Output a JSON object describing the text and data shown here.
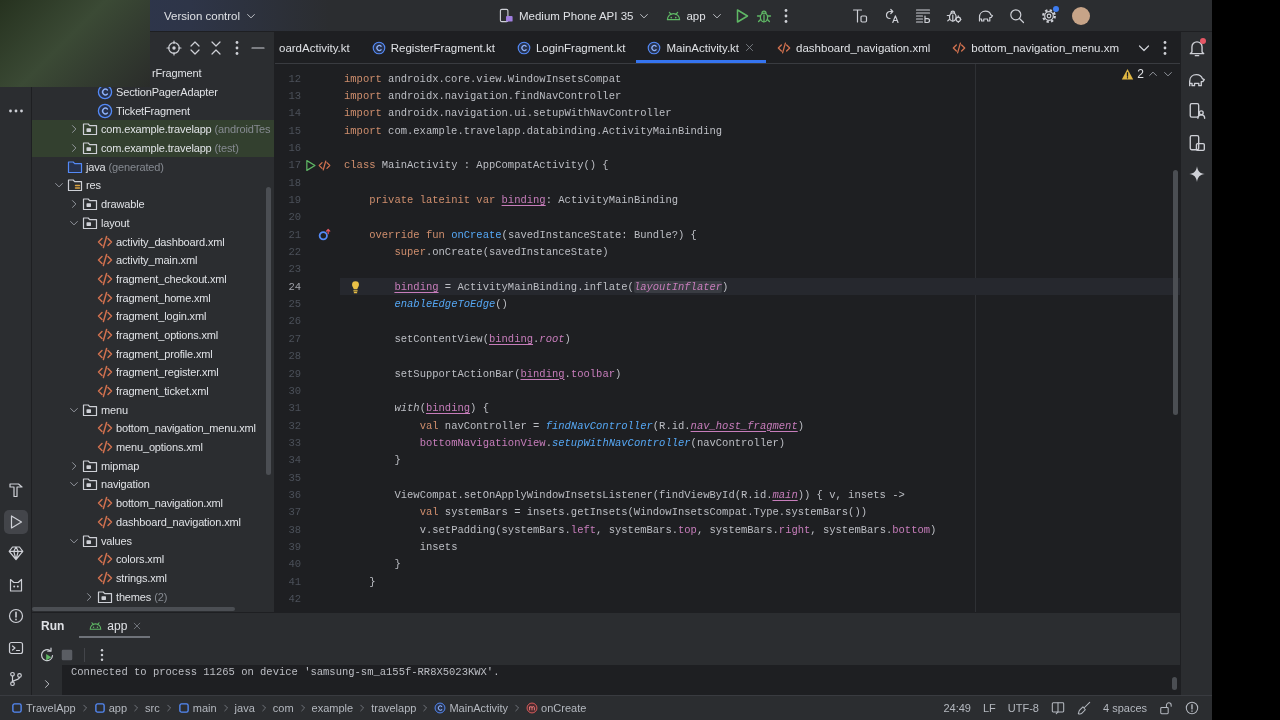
{
  "overlay": {
    "kind": "webcam-video"
  },
  "top_bar": {
    "vcs": "Version control",
    "device": "Medium Phone API 35",
    "run_config": "app",
    "settings_badge": true
  },
  "tool_windows": [
    {
      "kind": "build",
      "selected": false
    },
    {
      "kind": "run",
      "selected": true
    },
    {
      "kind": "quality",
      "selected": false
    },
    {
      "kind": "logcat",
      "selected": false
    },
    {
      "kind": "problems",
      "selected": false
    },
    {
      "kind": "terminal",
      "selected": false
    },
    {
      "kind": "vcs",
      "selected": false
    }
  ],
  "project": {
    "tree": [
      {
        "children": [
          {
            "children": [
              {
                "label": "rFragment",
                "kind": "class",
                "covered": true
              },
              {
                "label": "SectionPagerAdapter",
                "kind": "class"
              },
              {
                "label": "TicketFragment",
                "kind": "class"
              }
            ]
          },
          {
            "label": "com.example.travelapp",
            "note": "(androidTes",
            "kind": "test-package",
            "expanded": false
          },
          {
            "label": "com.example.travelapp",
            "note": "(test)",
            "kind": "test-package",
            "expanded": false
          }
        ]
      },
      {
        "label": "java",
        "note": "(generated)",
        "kind": "source-folder"
      },
      {
        "label": "res",
        "kind": "res-folder",
        "expanded": true,
        "children": [
          {
            "label": "drawable",
            "kind": "folder",
            "expanded": false
          },
          {
            "label": "layout",
            "kind": "folder",
            "expanded": true,
            "children": [
              {
                "label": "activity_dashboard.xml",
                "kind": "xml"
              },
              {
                "label": "activity_main.xml",
                "kind": "xml"
              },
              {
                "label": "fragment_checkout.xml",
                "kind": "xml"
              },
              {
                "label": "fragment_home.xml",
                "kind": "xml"
              },
              {
                "label": "fragment_login.xml",
                "kind": "xml"
              },
              {
                "label": "fragment_options.xml",
                "kind": "xml"
              },
              {
                "label": "fragment_profile.xml",
                "kind": "xml"
              },
              {
                "label": "fragment_register.xml",
                "kind": "xml"
              },
              {
                "label": "fragment_ticket.xml",
                "kind": "xml"
              }
            ]
          },
          {
            "label": "menu",
            "kind": "folder",
            "expanded": true,
            "children": [
              {
                "label": "bottom_navigation_menu.xml",
                "kind": "xml"
              },
              {
                "label": "menu_options.xml",
                "kind": "xml"
              }
            ]
          },
          {
            "label": "mipmap",
            "kind": "folder",
            "expanded": false
          },
          {
            "label": "navigation",
            "kind": "folder",
            "expanded": true,
            "children": [
              {
                "label": "bottom_navigation.xml",
                "kind": "xml"
              },
              {
                "label": "dashboard_navigation.xml",
                "kind": "xml"
              }
            ]
          },
          {
            "label": "values",
            "kind": "folder",
            "expanded": true,
            "children": [
              {
                "label": "colors.xml",
                "kind": "xml"
              },
              {
                "label": "strings.xml",
                "kind": "xml"
              },
              {
                "label": "themes",
                "note": "(2)",
                "kind": "folder",
                "expanded": false
              }
            ]
          }
        ]
      }
    ]
  },
  "editor": {
    "tabs": [
      {
        "label": "oardActivity.kt",
        "selected": false
      },
      {
        "label": "RegisterFragment.kt",
        "kind": "kotlin",
        "selected": false
      },
      {
        "label": "LoginFragment.kt",
        "kind": "kotlin",
        "selected": false
      },
      {
        "label": "MainActivity.kt",
        "kind": "kotlin",
        "selected": true
      },
      {
        "label": "dashboard_navigation.xml",
        "kind": "xml",
        "selected": false
      },
      {
        "label": "bottom_navigation_menu.xm",
        "kind": "xml",
        "selected": false
      }
    ],
    "warnings": "2",
    "lines": [
      {
        "number": "12",
        "current": false,
        "tokens": [
          {
            "text": "import",
            "kind": "keyword"
          },
          {
            "text": " androidx.core.view.WindowInsetsCompat",
            "kind": "plain"
          }
        ]
      },
      {
        "number": "13",
        "current": false,
        "tokens": [
          {
            "text": "import",
            "kind": "keyword"
          },
          {
            "text": " androidx.navigation.findNavController",
            "kind": "plain"
          }
        ]
      },
      {
        "number": "14",
        "current": false,
        "tokens": [
          {
            "text": "import",
            "kind": "keyword"
          },
          {
            "text": " androidx.navigation.ui.setupWithNavController",
            "kind": "plain"
          }
        ]
      },
      {
        "number": "15",
        "current": false,
        "tokens": [
          {
            "text": "import",
            "kind": "keyword"
          },
          {
            "text": " com.example.travelapp.databinding.ActivityMainBinding",
            "kind": "plain"
          }
        ]
      },
      {
        "number": "16",
        "current": false
      },
      {
        "number": "17",
        "current": false,
        "gutter": [
          {
            "kind": "run"
          },
          {
            "kind": "layout"
          }
        ],
        "tokens": [
          {
            "text": "class",
            "kind": "keyword"
          },
          {
            "text": " MainActivity : AppCompatActivity() {",
            "kind": "plain"
          }
        ]
      },
      {
        "number": "18",
        "current": false
      },
      {
        "number": "19",
        "current": false,
        "tokens": [
          {
            "text": "    private lateinit var",
            "kind": "keyword"
          },
          {
            "text": " binding",
            "kind": "reference"
          },
          {
            "text": ": ActivityMainBinding",
            "kind": "plain"
          }
        ]
      },
      {
        "number": "20",
        "current": false
      },
      {
        "number": "21",
        "current": false,
        "gutter": [
          {
            "kind": "override"
          }
        ],
        "tokens": [
          {
            "text": "    override fun",
            "kind": "keyword"
          },
          {
            "text": " onCreate",
            "kind": "function"
          },
          {
            "text": "(savedInstanceState: Bundle?) {",
            "kind": "plain"
          }
        ]
      },
      {
        "number": "22",
        "current": false,
        "tokens": [
          {
            "text": "        super",
            "kind": "keyword"
          },
          {
            "text": ".onCreate(savedInstanceState)",
            "kind": "plain"
          }
        ]
      },
      {
        "number": "23",
        "current": false
      },
      {
        "number": "24",
        "current": true,
        "gutter": [
          {
            "kind": "bulb"
          }
        ],
        "tokens": [
          {
            "text": "        binding",
            "kind": "reference"
          },
          {
            "text": " = ActivityMainBinding.inflate(",
            "kind": "plain"
          },
          {
            "text": "layoutInflater",
            "kind": "marked"
          },
          {
            "text": ")",
            "kind": "plain"
          }
        ]
      },
      {
        "number": "25",
        "current": false,
        "tokens": [
          {
            "text": "        enableEdgeToEdge",
            "kind": "call"
          },
          {
            "text": "()",
            "kind": "plain"
          }
        ]
      },
      {
        "number": "26",
        "current": false
      },
      {
        "number": "27",
        "current": false,
        "tokens": [
          {
            "text": "        setContentView(",
            "kind": "plain"
          },
          {
            "text": "binding",
            "kind": "reference"
          },
          {
            "text": ".",
            "kind": "plain"
          },
          {
            "text": "root",
            "kind": "property-italic"
          },
          {
            "text": ")",
            "kind": "plain"
          }
        ]
      },
      {
        "number": "28",
        "current": false
      },
      {
        "number": "29",
        "current": false,
        "tokens": [
          {
            "text": "        setSupportActionBar(",
            "kind": "plain"
          },
          {
            "text": "binding",
            "kind": "reference"
          },
          {
            "text": ".",
            "kind": "plain"
          },
          {
            "text": "toolbar",
            "kind": "property"
          },
          {
            "text": ")",
            "kind": "plain"
          }
        ]
      },
      {
        "number": "30",
        "current": false
      },
      {
        "number": "31",
        "current": false,
        "tokens": [
          {
            "text": "        with",
            "kind": "italic"
          },
          {
            "text": "(",
            "kind": "plain"
          },
          {
            "text": "binding",
            "kind": "reference"
          },
          {
            "text": ") {",
            "kind": "plain"
          }
        ]
      },
      {
        "number": "32",
        "current": false,
        "tokens": [
          {
            "text": "            val",
            "kind": "keyword"
          },
          {
            "text": " navController = ",
            "kind": "plain"
          },
          {
            "text": "findNavController",
            "kind": "call"
          },
          {
            "text": "(R.id.",
            "kind": "plain"
          },
          {
            "text": "nav_host_fragment",
            "kind": "reference-italic"
          },
          {
            "text": ")",
            "kind": "plain"
          }
        ]
      },
      {
        "number": "33",
        "current": false,
        "tokens": [
          {
            "text": "            bottomNavigationView",
            "kind": "property"
          },
          {
            "text": ".",
            "kind": "plain"
          },
          {
            "text": "setupWithNavController",
            "kind": "call"
          },
          {
            "text": "(navController)",
            "kind": "plain"
          }
        ]
      },
      {
        "number": "34",
        "current": false,
        "tokens": [
          {
            "text": "        }",
            "kind": "plain"
          }
        ]
      },
      {
        "number": "35",
        "current": false
      },
      {
        "number": "36",
        "current": false,
        "tokens": [
          {
            "text": "        ViewCompat.setOnApplyWindowInsetsListener(findViewById(R.id.",
            "kind": "plain"
          },
          {
            "text": "main",
            "kind": "reference-italic"
          },
          {
            "text": ")) { v, insets ->",
            "kind": "plain"
          }
        ]
      },
      {
        "number": "37",
        "current": false,
        "tokens": [
          {
            "text": "            val",
            "kind": "keyword"
          },
          {
            "text": " systemBars = insets.getInsets(WindowInsetsCompat.Type.systemBars())",
            "kind": "plain"
          }
        ]
      },
      {
        "number": "38",
        "current": false,
        "tokens": [
          {
            "text": "            v.setPadding(systemBars.",
            "kind": "plain"
          },
          {
            "text": "left",
            "kind": "property"
          },
          {
            "text": ", systemBars.",
            "kind": "plain"
          },
          {
            "text": "top",
            "kind": "property"
          },
          {
            "text": ", systemBars.",
            "kind": "plain"
          },
          {
            "text": "right",
            "kind": "property"
          },
          {
            "text": ", systemBars.",
            "kind": "plain"
          },
          {
            "text": "bottom",
            "kind": "property"
          },
          {
            "text": ")",
            "kind": "plain"
          }
        ]
      },
      {
        "number": "39",
        "current": false,
        "tokens": [
          {
            "text": "            insets",
            "kind": "plain"
          }
        ]
      },
      {
        "number": "40",
        "current": false,
        "tokens": [
          {
            "text": "        }",
            "kind": "plain"
          }
        ]
      },
      {
        "number": "41",
        "current": false,
        "tokens": [
          {
            "text": "    }",
            "kind": "plain"
          }
        ]
      },
      {
        "number": "42",
        "current": false
      }
    ]
  },
  "side_bar": {
    "notifications_unread": true
  },
  "run_panel": {
    "title": "Run",
    "tabs": [
      {
        "label": "app",
        "selected": true
      }
    ],
    "console": [
      "Connected to process 11265 on device 'samsung-sm_a155f-RR8X5023KWX'."
    ]
  },
  "status_bar": {
    "breadcrumbs": [
      {
        "label": "TravelApp",
        "kind": "module"
      },
      {
        "label": "app",
        "kind": "module"
      },
      {
        "label": "src"
      },
      {
        "label": "main",
        "kind": "module"
      },
      {
        "label": "java"
      },
      {
        "label": "com"
      },
      {
        "label": "example"
      },
      {
        "label": "travelapp"
      },
      {
        "label": "MainActivity",
        "kind": "class"
      },
      {
        "label": "onCreate",
        "kind": "method"
      }
    ],
    "position": "24:49",
    "line_separator": "LF",
    "encoding": "UTF-8",
    "indent": "4 spaces"
  }
}
